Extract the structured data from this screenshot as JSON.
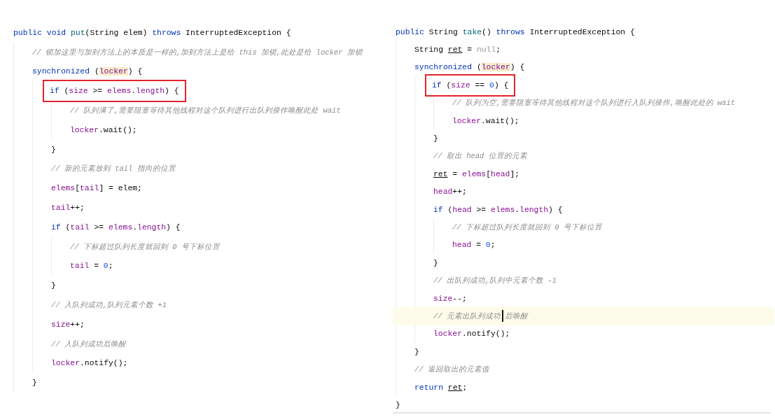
{
  "panels": [
    {
      "lines": [
        {
          "boxed": false,
          "current": false,
          "tokens": [
            {
              "kind": "kw",
              "text": "public void "
            },
            {
              "kind": "method",
              "text": "put"
            },
            {
              "kind": "plain",
              "text": "(String elem) "
            },
            {
              "kind": "kw",
              "text": "throws "
            },
            {
              "kind": "plain",
              "text": "InterruptedException {"
            }
          ],
          "children": [
            {
              "boxed": false,
              "current": false,
              "tokens": [
                {
                  "kind": "comment",
                  "text": "// 锁加这里与加到方法上的本质是一样的,加到方法上是给 this 加锁,此处是给 locker 加锁"
                }
              ]
            },
            {
              "boxed": false,
              "current": false,
              "tokens": [
                {
                  "kind": "kw",
                  "text": "synchronized "
                },
                {
                  "kind": "plain",
                  "text": "("
                },
                {
                  "kind": "match",
                  "text": "locker"
                },
                {
                  "kind": "plain",
                  "text": ") {"
                }
              ],
              "children": [
                {
                  "boxed": true,
                  "current": false,
                  "tokens": [
                    {
                      "kind": "kw",
                      "text": "if "
                    },
                    {
                      "kind": "plain",
                      "text": "("
                    },
                    {
                      "kind": "field",
                      "text": "size"
                    },
                    {
                      "kind": "plain",
                      "text": " >= "
                    },
                    {
                      "kind": "field",
                      "text": "elems"
                    },
                    {
                      "kind": "plain",
                      "text": "."
                    },
                    {
                      "kind": "field",
                      "text": "length"
                    },
                    {
                      "kind": "plain",
                      "text": ") {"
                    }
                  ],
                  "children": [
                    {
                      "boxed": false,
                      "current": false,
                      "tokens": [
                        {
                          "kind": "comment",
                          "text": "// 队列满了,需要阻塞等待其他线程对这个队列进行出队列操作唤醒此处 wait"
                        }
                      ]
                    },
                    {
                      "boxed": false,
                      "current": false,
                      "tokens": [
                        {
                          "kind": "field",
                          "text": "locker"
                        },
                        {
                          "kind": "plain",
                          "text": ".wait();"
                        }
                      ]
                    }
                  ]
                },
                {
                  "boxed": false,
                  "current": false,
                  "tokens": [
                    {
                      "kind": "plain",
                      "text": "}"
                    }
                  ]
                },
                {
                  "boxed": false,
                  "current": false,
                  "tokens": [
                    {
                      "kind": "comment",
                      "text": "// 新的元素放到 tail 指向的位置"
                    }
                  ]
                },
                {
                  "boxed": false,
                  "current": false,
                  "tokens": [
                    {
                      "kind": "field",
                      "text": "elems"
                    },
                    {
                      "kind": "plain",
                      "text": "["
                    },
                    {
                      "kind": "field",
                      "text": "tail"
                    },
                    {
                      "kind": "plain",
                      "text": "] = elem;"
                    }
                  ]
                },
                {
                  "boxed": false,
                  "current": false,
                  "tokens": [
                    {
                      "kind": "field",
                      "text": "tail"
                    },
                    {
                      "kind": "plain",
                      "text": "++;"
                    }
                  ]
                },
                {
                  "boxed": false,
                  "current": false,
                  "tokens": [
                    {
                      "kind": "kw",
                      "text": "if "
                    },
                    {
                      "kind": "plain",
                      "text": "("
                    },
                    {
                      "kind": "field",
                      "text": "tail"
                    },
                    {
                      "kind": "plain",
                      "text": " >= "
                    },
                    {
                      "kind": "field",
                      "text": "elems"
                    },
                    {
                      "kind": "plain",
                      "text": "."
                    },
                    {
                      "kind": "field",
                      "text": "length"
                    },
                    {
                      "kind": "plain",
                      "text": ") {"
                    }
                  ],
                  "children": [
                    {
                      "boxed": false,
                      "current": false,
                      "tokens": [
                        {
                          "kind": "comment",
                          "text": "// 下标超过队列长度就回到 0 号下标位置"
                        }
                      ]
                    },
                    {
                      "boxed": false,
                      "current": false,
                      "tokens": [
                        {
                          "kind": "field",
                          "text": "tail"
                        },
                        {
                          "kind": "plain",
                          "text": " = "
                        },
                        {
                          "kind": "num",
                          "text": "0"
                        },
                        {
                          "kind": "plain",
                          "text": ";"
                        }
                      ]
                    }
                  ]
                },
                {
                  "boxed": false,
                  "current": false,
                  "tokens": [
                    {
                      "kind": "plain",
                      "text": "}"
                    }
                  ]
                },
                {
                  "boxed": false,
                  "current": false,
                  "tokens": [
                    {
                      "kind": "comment",
                      "text": "// 入队列成功,队列元素个数 +1"
                    }
                  ]
                },
                {
                  "boxed": false,
                  "current": false,
                  "tokens": [
                    {
                      "kind": "field",
                      "text": "size"
                    },
                    {
                      "kind": "plain",
                      "text": "++;"
                    }
                  ]
                },
                {
                  "boxed": false,
                  "current": false,
                  "tokens": [
                    {
                      "kind": "comment",
                      "text": "// 入队列成功后唤醒"
                    }
                  ]
                },
                {
                  "boxed": false,
                  "current": false,
                  "tokens": [
                    {
                      "kind": "field",
                      "text": "locker"
                    },
                    {
                      "kind": "plain",
                      "text": ".notify();"
                    }
                  ]
                }
              ]
            },
            {
              "boxed": false,
              "current": false,
              "tokens": [
                {
                  "kind": "plain",
                  "text": "}"
                }
              ]
            }
          ]
        }
      ]
    },
    {
      "lines": [
        {
          "boxed": false,
          "current": false,
          "tokens": [
            {
              "kind": "kw",
              "text": "public "
            },
            {
              "kind": "plain",
              "text": "String "
            },
            {
              "kind": "method",
              "text": "take"
            },
            {
              "kind": "plain",
              "text": "() "
            },
            {
              "kind": "kw",
              "text": "throws "
            },
            {
              "kind": "plain",
              "text": "InterruptedException {"
            }
          ],
          "children": [
            {
              "boxed": false,
              "current": false,
              "tokens": [
                {
                  "kind": "plain",
                  "text": "String "
                },
                {
                  "kind": "var",
                  "text": "ret"
                },
                {
                  "kind": "plain",
                  "text": " = "
                },
                {
                  "kind": "null",
                  "text": "null"
                },
                {
                  "kind": "plain",
                  "text": ";"
                }
              ]
            },
            {
              "boxed": false,
              "current": false,
              "tokens": [
                {
                  "kind": "kw",
                  "text": "synchronized "
                },
                {
                  "kind": "plain",
                  "text": "("
                },
                {
                  "kind": "match",
                  "text": "locker"
                },
                {
                  "kind": "plain",
                  "text": ") {"
                }
              ],
              "children": [
                {
                  "boxed": true,
                  "current": false,
                  "tokens": [
                    {
                      "kind": "kw",
                      "text": "if "
                    },
                    {
                      "kind": "plain",
                      "text": "("
                    },
                    {
                      "kind": "field",
                      "text": "size"
                    },
                    {
                      "kind": "plain",
                      "text": " == "
                    },
                    {
                      "kind": "num",
                      "text": "0"
                    },
                    {
                      "kind": "plain",
                      "text": ") {"
                    }
                  ],
                  "children": [
                    {
                      "boxed": false,
                      "current": false,
                      "tokens": [
                        {
                          "kind": "comment",
                          "text": "// 队列为空,需要阻塞等待其他线程对这个队列进行入队列操作,唤醒此处的 wait"
                        }
                      ]
                    },
                    {
                      "boxed": false,
                      "current": false,
                      "tokens": [
                        {
                          "kind": "field",
                          "text": "locker"
                        },
                        {
                          "kind": "plain",
                          "text": ".wait();"
                        }
                      ]
                    }
                  ]
                },
                {
                  "boxed": false,
                  "current": false,
                  "tokens": [
                    {
                      "kind": "plain",
                      "text": "}"
                    }
                  ]
                },
                {
                  "boxed": false,
                  "current": false,
                  "tokens": [
                    {
                      "kind": "comment",
                      "text": "// 取出 head 位置的元素"
                    }
                  ]
                },
                {
                  "boxed": false,
                  "current": false,
                  "tokens": [
                    {
                      "kind": "var",
                      "text": "ret"
                    },
                    {
                      "kind": "plain",
                      "text": " = "
                    },
                    {
                      "kind": "field",
                      "text": "elems"
                    },
                    {
                      "kind": "plain",
                      "text": "["
                    },
                    {
                      "kind": "field",
                      "text": "head"
                    },
                    {
                      "kind": "plain",
                      "text": "];"
                    }
                  ]
                },
                {
                  "boxed": false,
                  "current": false,
                  "tokens": [
                    {
                      "kind": "field",
                      "text": "head"
                    },
                    {
                      "kind": "plain",
                      "text": "++;"
                    }
                  ]
                },
                {
                  "boxed": false,
                  "current": false,
                  "tokens": [
                    {
                      "kind": "kw",
                      "text": "if "
                    },
                    {
                      "kind": "plain",
                      "text": "("
                    },
                    {
                      "kind": "field",
                      "text": "head"
                    },
                    {
                      "kind": "plain",
                      "text": " >= "
                    },
                    {
                      "kind": "field",
                      "text": "elems"
                    },
                    {
                      "kind": "plain",
                      "text": "."
                    },
                    {
                      "kind": "field",
                      "text": "length"
                    },
                    {
                      "kind": "plain",
                      "text": ") {"
                    }
                  ],
                  "children": [
                    {
                      "boxed": false,
                      "current": false,
                      "tokens": [
                        {
                          "kind": "comment",
                          "text": "// 下标超过队列长度就回到 0 号下标位置"
                        }
                      ]
                    },
                    {
                      "boxed": false,
                      "current": false,
                      "tokens": [
                        {
                          "kind": "field",
                          "text": "head"
                        },
                        {
                          "kind": "plain",
                          "text": " = "
                        },
                        {
                          "kind": "num",
                          "text": "0"
                        },
                        {
                          "kind": "plain",
                          "text": ";"
                        }
                      ]
                    }
                  ]
                },
                {
                  "boxed": false,
                  "current": false,
                  "tokens": [
                    {
                      "kind": "plain",
                      "text": "}"
                    }
                  ]
                },
                {
                  "boxed": false,
                  "current": false,
                  "tokens": [
                    {
                      "kind": "comment",
                      "text": "// 出队列成功,队列中元素个数 -1"
                    }
                  ]
                },
                {
                  "boxed": false,
                  "current": false,
                  "tokens": [
                    {
                      "kind": "field",
                      "text": "size"
                    },
                    {
                      "kind": "plain",
                      "text": "--;"
                    }
                  ]
                },
                {
                  "boxed": false,
                  "current": true,
                  "tokens": [
                    {
                      "kind": "comment",
                      "text": "// 元素出队列成功"
                    },
                    {
                      "kind": "caret"
                    },
                    {
                      "kind": "comment",
                      "text": "后唤醒"
                    }
                  ]
                },
                {
                  "boxed": false,
                  "current": false,
                  "tokens": [
                    {
                      "kind": "field",
                      "text": "locker"
                    },
                    {
                      "kind": "plain",
                      "text": ".notify();"
                    }
                  ]
                }
              ]
            },
            {
              "boxed": false,
              "current": false,
              "tokens": [
                {
                  "kind": "plain",
                  "text": "}"
                }
              ]
            },
            {
              "boxed": false,
              "current": false,
              "tokens": [
                {
                  "kind": "comment",
                  "text": "// 返回取出的元素值"
                }
              ]
            },
            {
              "boxed": false,
              "current": false,
              "tokens": [
                {
                  "kind": "kw",
                  "text": "return "
                },
                {
                  "kind": "var",
                  "text": "ret"
                },
                {
                  "kind": "plain",
                  "text": ";"
                }
              ]
            }
          ]
        },
        {
          "boxed": false,
          "current": false,
          "tokens": [
            {
              "kind": "plain",
              "text": "}"
            }
          ]
        }
      ]
    }
  ]
}
